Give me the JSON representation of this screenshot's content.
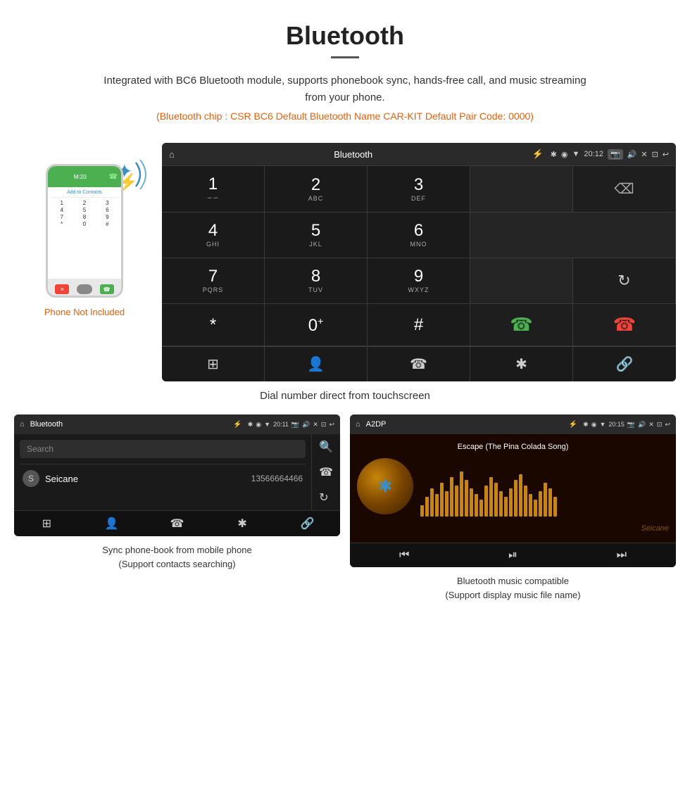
{
  "page": {
    "title": "Bluetooth",
    "divider": true,
    "description": "Integrated with BC6 Bluetooth module, supports phonebook sync, hands-free call, and music streaming from your phone.",
    "specs": "(Bluetooth chip : CSR BC6   Default Bluetooth Name CAR-KIT    Default Pair Code: 0000)"
  },
  "phone_mockup": {
    "not_included_label": "Phone Not Included",
    "screen_title": "M:20",
    "add_contact_label": "Add to Contacts",
    "dialpad_keys": [
      "1",
      "2",
      "3",
      "4",
      "5",
      "6",
      "7",
      "8",
      "9",
      "*",
      "0",
      "#"
    ],
    "call_label": "☎"
  },
  "dial_screen": {
    "status_bar": {
      "home_icon": "⌂",
      "title": "Bluetooth",
      "usb_icon": "⚡",
      "bt_icon": "✱",
      "location_icon": "◉",
      "signal_icon": "▼",
      "time": "20:12",
      "camera_label": "📷",
      "volume_icon": "🔊",
      "close_icon": "✕",
      "window_icon": "⊡",
      "back_icon": "↩"
    },
    "keys": [
      {
        "num": "1",
        "letters": "∽∽",
        "row": 0,
        "col": 0
      },
      {
        "num": "2",
        "letters": "ABC",
        "row": 0,
        "col": 1
      },
      {
        "num": "3",
        "letters": "DEF",
        "row": 0,
        "col": 2
      },
      {
        "num": "4",
        "letters": "GHI",
        "row": 1,
        "col": 0
      },
      {
        "num": "5",
        "letters": "JKL",
        "row": 1,
        "col": 1
      },
      {
        "num": "6",
        "letters": "MNO",
        "row": 1,
        "col": 2
      },
      {
        "num": "7",
        "letters": "PQRS",
        "row": 2,
        "col": 0
      },
      {
        "num": "8",
        "letters": "TUV",
        "row": 2,
        "col": 1
      },
      {
        "num": "9",
        "letters": "WXYZ",
        "row": 2,
        "col": 2
      },
      {
        "num": "*",
        "letters": "",
        "row": 3,
        "col": 0
      },
      {
        "num": "0⁺",
        "letters": "",
        "row": 3,
        "col": 1
      },
      {
        "num": "#",
        "letters": "",
        "row": 3,
        "col": 2
      }
    ],
    "caption": "Dial number direct from touchscreen",
    "nav": {
      "dialpad_icon": "⊞",
      "contacts_icon": "👤",
      "phone_icon": "☎",
      "bluetooth_icon": "✱",
      "link_icon": "🔗"
    }
  },
  "phonebook_screen": {
    "status_bar": {
      "home_icon": "⌂",
      "title": "Bluetooth",
      "usb_icon": "⚡",
      "bt_icon": "✱",
      "time": "20:11",
      "icons_right": "📷 🔊 ✕ ⊡ ↩"
    },
    "search_placeholder": "Search",
    "entry": {
      "letter": "S",
      "name": "Seicane",
      "number": "13566664466"
    },
    "right_icons": [
      "🔍",
      "☎",
      "↻"
    ],
    "bottom_nav": [
      "⊞",
      "👤",
      "☎",
      "✱",
      "🔗"
    ],
    "caption_line1": "Sync phone-book from mobile phone",
    "caption_line2": "(Support contacts searching)"
  },
  "music_screen": {
    "status_bar": {
      "home_icon": "⌂",
      "title": "A2DP",
      "usb_icon": "⚡",
      "time": "20:15",
      "icons_right": "📷 🔊 ✕ ⊡ ↩"
    },
    "song_title": "Escape (The Pina Colada Song)",
    "bt_icon": "✱",
    "note_icon": "♪",
    "eq_bars": [
      20,
      35,
      50,
      40,
      60,
      45,
      70,
      55,
      80,
      65,
      50,
      40,
      30,
      55,
      70,
      60,
      45,
      35,
      50,
      65,
      75,
      55,
      40,
      30,
      45,
      60,
      50,
      35
    ],
    "bottom_nav": [
      "⏮",
      "⏯",
      "⏭"
    ],
    "watermark": "Seicane",
    "caption_line1": "Bluetooth music compatible",
    "caption_line2": "(Support display music file name)"
  }
}
